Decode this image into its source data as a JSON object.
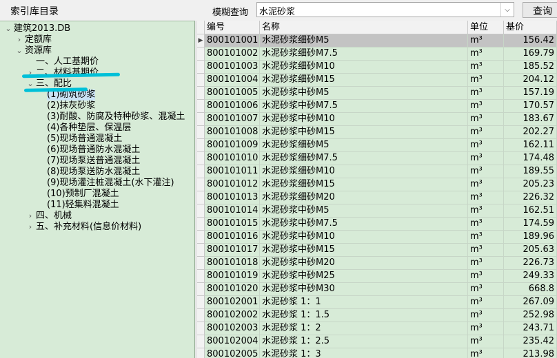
{
  "header": {
    "index_title": "索引库目录",
    "search_label": "模糊查询",
    "search_value": "水泥砂浆",
    "query_button": "查询"
  },
  "tree": [
    {
      "arrow": "⌄",
      "label": "建筑2013.DB"
    },
    {
      "arrow": "›",
      "label": "定额库"
    },
    {
      "arrow": "⌄",
      "label": "资源库"
    },
    {
      "arrow": "",
      "label": "一、人工基期价"
    },
    {
      "arrow": "›",
      "label": "二、材料基期价"
    },
    {
      "arrow": "⌄",
      "label": "三、配比"
    },
    {
      "arrow": "",
      "label": "(1)砌筑砂浆",
      "selected": true
    },
    {
      "arrow": "",
      "label": "(2)抹灰砂浆"
    },
    {
      "arrow": "",
      "label": "(3)耐酸、防腐及特种砂浆、混凝土"
    },
    {
      "arrow": "",
      "label": "(4)各种垫层、保温层"
    },
    {
      "arrow": "",
      "label": "(5)现场普通混凝土"
    },
    {
      "arrow": "",
      "label": "(6)现场普通防水混凝土"
    },
    {
      "arrow": "",
      "label": "(7)现场泵送普通混凝土"
    },
    {
      "arrow": "",
      "label": "(8)现场泵送防水混凝土"
    },
    {
      "arrow": "",
      "label": "(9)现场灌注桩混凝土(水下灌注)"
    },
    {
      "arrow": "",
      "label": "(10)预制厂混凝土"
    },
    {
      "arrow": "",
      "label": "(11)轻集料混凝土"
    },
    {
      "arrow": "›",
      "label": "四、机械"
    },
    {
      "arrow": "›",
      "label": "五、补充材料(信息价材料)"
    }
  ],
  "table": {
    "columns": [
      "编号",
      "名称",
      "单位",
      "基价"
    ],
    "rows": [
      [
        "800101001",
        "水泥砂浆细砂M5",
        "m³",
        "156.42"
      ],
      [
        "800101002",
        "水泥砂浆细砂M7.5",
        "m³",
        "169.79"
      ],
      [
        "800101003",
        "水泥砂浆细砂M10",
        "m³",
        "185.52"
      ],
      [
        "800101004",
        "水泥砂浆细砂M15",
        "m³",
        "204.12"
      ],
      [
        "800101005",
        "水泥砂浆中砂M5",
        "m³",
        "157.19"
      ],
      [
        "800101006",
        "水泥砂浆中砂M7.5",
        "m³",
        "170.57"
      ],
      [
        "800101007",
        "水泥砂浆中砂M10",
        "m³",
        "183.67"
      ],
      [
        "800101008",
        "水泥砂浆中砂M15",
        "m³",
        "202.27"
      ],
      [
        "800101009",
        "水泥砂浆细砂M5",
        "m³",
        "162.11"
      ],
      [
        "800101010",
        "水泥砂浆细砂M7.5",
        "m³",
        "174.48"
      ],
      [
        "800101011",
        "水泥砂浆细砂M10",
        "m³",
        "189.55"
      ],
      [
        "800101012",
        "水泥砂浆细砂M15",
        "m³",
        "205.23"
      ],
      [
        "800101013",
        "水泥砂浆细砂M20",
        "m³",
        "226.32"
      ],
      [
        "800101014",
        "水泥砂浆中砂M5",
        "m³",
        "162.51"
      ],
      [
        "800101015",
        "水泥砂浆中砂M7.5",
        "m³",
        "174.59"
      ],
      [
        "800101016",
        "水泥砂浆中砂M10",
        "m³",
        "189.96"
      ],
      [
        "800101017",
        "水泥砂浆中砂M15",
        "m³",
        "205.63"
      ],
      [
        "800101018",
        "水泥砂浆中砂M20",
        "m³",
        "226.73"
      ],
      [
        "800101019",
        "水泥砂浆中砂M25",
        "m³",
        "249.33"
      ],
      [
        "800101020",
        "水泥砂浆中砂M30",
        "m³",
        "668.8"
      ],
      [
        "800102001",
        "水泥砂浆 1：1",
        "m³",
        "267.09"
      ],
      [
        "800102002",
        "水泥砂浆 1：1.5",
        "m³",
        "252.98"
      ],
      [
        "800102003",
        "水泥砂浆 1：2",
        "m³",
        "243.71"
      ],
      [
        "800102004",
        "水泥砂浆 1：2.5",
        "m³",
        "235.42"
      ],
      [
        "800102005",
        "水泥砂浆 1：3",
        "m³",
        "213.98"
      ]
    ]
  },
  "colors": {
    "panel_green": "#d7ebd7",
    "highlight_cyan": "#00c0d8",
    "selected_row": "#c3c3c3"
  }
}
